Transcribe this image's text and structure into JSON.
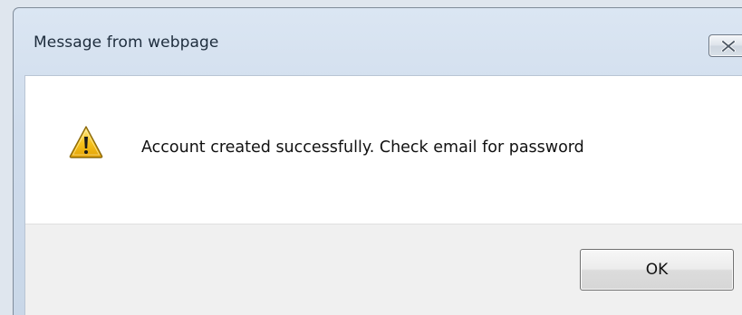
{
  "dialog": {
    "title": "Message from webpage",
    "message": "Account created successfully. Check email for password",
    "icon": "warning-icon",
    "ok_label": "OK",
    "close_icon": "close-icon"
  },
  "colors": {
    "title_bar": "#d3dfed",
    "content_bg": "#ffffff",
    "button_bar_bg": "#f0f0f0",
    "warning_yellow": "#f7c21a"
  }
}
